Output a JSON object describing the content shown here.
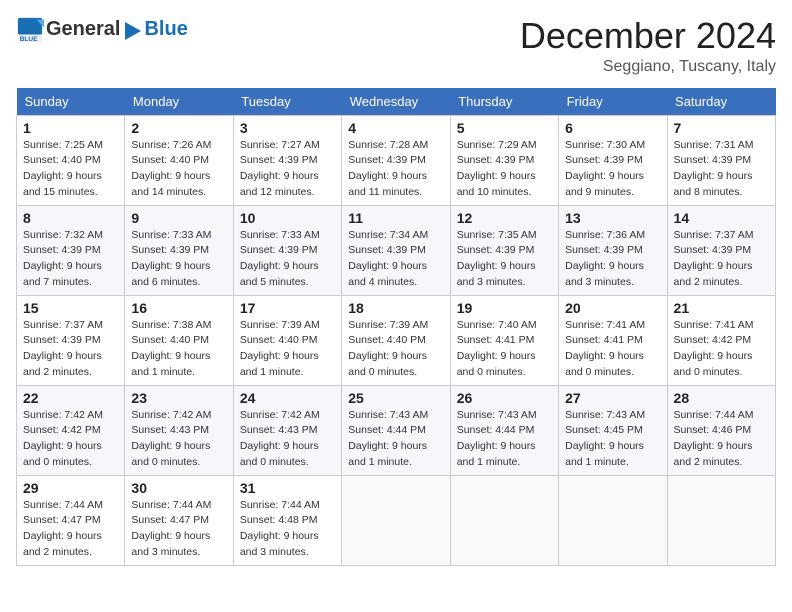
{
  "header": {
    "logo": {
      "general": "General",
      "blue": "Blue"
    },
    "title": "December 2024",
    "location": "Seggiano, Tuscany, Italy"
  },
  "calendar": {
    "columns": [
      "Sunday",
      "Monday",
      "Tuesday",
      "Wednesday",
      "Thursday",
      "Friday",
      "Saturday"
    ],
    "rows": [
      [
        {
          "day": "1",
          "sunrise": "7:25 AM",
          "sunset": "4:40 PM",
          "daylight": "9 hours and 15 minutes."
        },
        {
          "day": "2",
          "sunrise": "7:26 AM",
          "sunset": "4:40 PM",
          "daylight": "9 hours and 14 minutes."
        },
        {
          "day": "3",
          "sunrise": "7:27 AM",
          "sunset": "4:39 PM",
          "daylight": "9 hours and 12 minutes."
        },
        {
          "day": "4",
          "sunrise": "7:28 AM",
          "sunset": "4:39 PM",
          "daylight": "9 hours and 11 minutes."
        },
        {
          "day": "5",
          "sunrise": "7:29 AM",
          "sunset": "4:39 PM",
          "daylight": "9 hours and 10 minutes."
        },
        {
          "day": "6",
          "sunrise": "7:30 AM",
          "sunset": "4:39 PM",
          "daylight": "9 hours and 9 minutes."
        },
        {
          "day": "7",
          "sunrise": "7:31 AM",
          "sunset": "4:39 PM",
          "daylight": "9 hours and 8 minutes."
        }
      ],
      [
        {
          "day": "8",
          "sunrise": "7:32 AM",
          "sunset": "4:39 PM",
          "daylight": "9 hours and 7 minutes."
        },
        {
          "day": "9",
          "sunrise": "7:33 AM",
          "sunset": "4:39 PM",
          "daylight": "9 hours and 6 minutes."
        },
        {
          "day": "10",
          "sunrise": "7:33 AM",
          "sunset": "4:39 PM",
          "daylight": "9 hours and 5 minutes."
        },
        {
          "day": "11",
          "sunrise": "7:34 AM",
          "sunset": "4:39 PM",
          "daylight": "9 hours and 4 minutes."
        },
        {
          "day": "12",
          "sunrise": "7:35 AM",
          "sunset": "4:39 PM",
          "daylight": "9 hours and 3 minutes."
        },
        {
          "day": "13",
          "sunrise": "7:36 AM",
          "sunset": "4:39 PM",
          "daylight": "9 hours and 3 minutes."
        },
        {
          "day": "14",
          "sunrise": "7:37 AM",
          "sunset": "4:39 PM",
          "daylight": "9 hours and 2 minutes."
        }
      ],
      [
        {
          "day": "15",
          "sunrise": "7:37 AM",
          "sunset": "4:39 PM",
          "daylight": "9 hours and 2 minutes."
        },
        {
          "day": "16",
          "sunrise": "7:38 AM",
          "sunset": "4:40 PM",
          "daylight": "9 hours and 1 minute."
        },
        {
          "day": "17",
          "sunrise": "7:39 AM",
          "sunset": "4:40 PM",
          "daylight": "9 hours and 1 minute."
        },
        {
          "day": "18",
          "sunrise": "7:39 AM",
          "sunset": "4:40 PM",
          "daylight": "9 hours and 0 minutes."
        },
        {
          "day": "19",
          "sunrise": "7:40 AM",
          "sunset": "4:41 PM",
          "daylight": "9 hours and 0 minutes."
        },
        {
          "day": "20",
          "sunrise": "7:41 AM",
          "sunset": "4:41 PM",
          "daylight": "9 hours and 0 minutes."
        },
        {
          "day": "21",
          "sunrise": "7:41 AM",
          "sunset": "4:42 PM",
          "daylight": "9 hours and 0 minutes."
        }
      ],
      [
        {
          "day": "22",
          "sunrise": "7:42 AM",
          "sunset": "4:42 PM",
          "daylight": "9 hours and 0 minutes."
        },
        {
          "day": "23",
          "sunrise": "7:42 AM",
          "sunset": "4:43 PM",
          "daylight": "9 hours and 0 minutes."
        },
        {
          "day": "24",
          "sunrise": "7:42 AM",
          "sunset": "4:43 PM",
          "daylight": "9 hours and 0 minutes."
        },
        {
          "day": "25",
          "sunrise": "7:43 AM",
          "sunset": "4:44 PM",
          "daylight": "9 hours and 1 minute."
        },
        {
          "day": "26",
          "sunrise": "7:43 AM",
          "sunset": "4:44 PM",
          "daylight": "9 hours and 1 minute."
        },
        {
          "day": "27",
          "sunrise": "7:43 AM",
          "sunset": "4:45 PM",
          "daylight": "9 hours and 1 minute."
        },
        {
          "day": "28",
          "sunrise": "7:44 AM",
          "sunset": "4:46 PM",
          "daylight": "9 hours and 2 minutes."
        }
      ],
      [
        {
          "day": "29",
          "sunrise": "7:44 AM",
          "sunset": "4:47 PM",
          "daylight": "9 hours and 2 minutes."
        },
        {
          "day": "30",
          "sunrise": "7:44 AM",
          "sunset": "4:47 PM",
          "daylight": "9 hours and 3 minutes."
        },
        {
          "day": "31",
          "sunrise": "7:44 AM",
          "sunset": "4:48 PM",
          "daylight": "9 hours and 3 minutes."
        },
        null,
        null,
        null,
        null
      ]
    ]
  }
}
